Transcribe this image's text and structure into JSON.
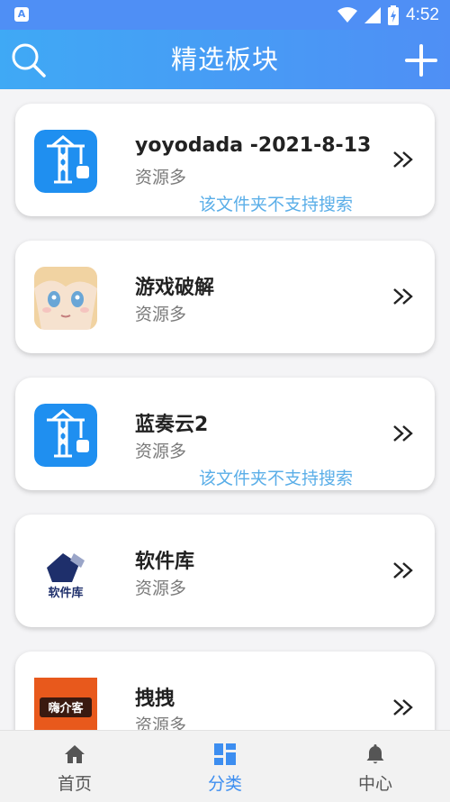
{
  "status_bar": {
    "app_icon_letter": "A",
    "time": "4:52"
  },
  "header": {
    "title": "精选板块"
  },
  "boards": [
    {
      "title": "yoyodada -2021-8-13",
      "subtitle": "资源多",
      "note": "该文件夹不支持搜索",
      "thumb": "crane-app-icon"
    },
    {
      "title": "游戏破解",
      "subtitle": "资源多",
      "note": "",
      "thumb": "anime-avatar"
    },
    {
      "title": "蓝奏云2",
      "subtitle": "资源多",
      "note": "该文件夹不支持搜索",
      "thumb": "crane-app-icon"
    },
    {
      "title": "软件库",
      "subtitle": "资源多",
      "note": "",
      "thumb": "software-library-logo",
      "logo_text": "软件库"
    },
    {
      "title": "拽拽",
      "subtitle": "资源多",
      "note": "",
      "thumb": "orange-logo",
      "logo_text": "嗨介客"
    }
  ],
  "bottom_nav": [
    {
      "label": "首页",
      "icon": "home-icon",
      "active": false
    },
    {
      "label": "分类",
      "icon": "category-grid-icon",
      "active": true
    },
    {
      "label": "中心",
      "icon": "bell-icon",
      "active": false
    }
  ],
  "colors": {
    "header": "#4f8ff5",
    "accent": "#3d8ef0",
    "note": "#5aaee8",
    "inactive_nav": "#555555"
  }
}
